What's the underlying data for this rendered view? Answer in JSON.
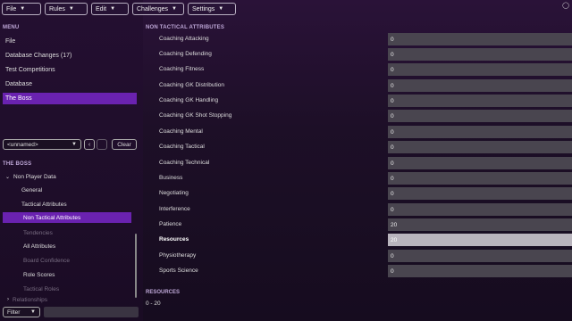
{
  "toolbar": {
    "menus": [
      "File",
      "Rules",
      "Edit",
      "Challenges",
      "Settings"
    ]
  },
  "menu": {
    "heading": "MENU",
    "items": [
      "File",
      "Database Changes (17)",
      "Test Competitions",
      "Database",
      "The Boss"
    ]
  },
  "filter_row": {
    "selected": "<unnamed>",
    "clear_label": "Clear"
  },
  "tree": {
    "heading": "THE BOSS",
    "root": "Non Player Data",
    "items": [
      "General",
      "Tactical Attributes",
      "Non Tactical Attributes",
      "Tendencies",
      "All Attributes",
      "Board Confidence",
      "Role Scores",
      "Tactical Roles",
      "Relationships"
    ]
  },
  "bottom": {
    "filter_label": "Filter"
  },
  "attributes": {
    "heading": "NON TACTICAL ATTRIBUTES",
    "rows": [
      {
        "label": "Coaching Attacking",
        "value": "0"
      },
      {
        "label": "Coaching Defending",
        "value": "0"
      },
      {
        "label": "Coaching Fitness",
        "value": "0"
      },
      {
        "label": "Coaching GK Distribution",
        "value": "0"
      },
      {
        "label": "Coaching GK Handling",
        "value": "0"
      },
      {
        "label": "Coaching GK Shot Stopping",
        "value": "0"
      },
      {
        "label": "Coaching Mental",
        "value": "0"
      },
      {
        "label": "Coaching Tactical",
        "value": "0"
      },
      {
        "label": "Coaching Technical",
        "value": "0"
      },
      {
        "label": "Business",
        "value": "0"
      },
      {
        "label": "Negotiating",
        "value": "0"
      },
      {
        "label": "Interference",
        "value": "0"
      },
      {
        "label": "Patience",
        "value": "20"
      },
      {
        "label": "Resources",
        "value": "20"
      },
      {
        "label": "Physiotherapy",
        "value": "0"
      },
      {
        "label": "Sports Science",
        "value": "0"
      }
    ]
  },
  "resources": {
    "heading": "RESOURCES",
    "range": "0 - 20"
  }
}
